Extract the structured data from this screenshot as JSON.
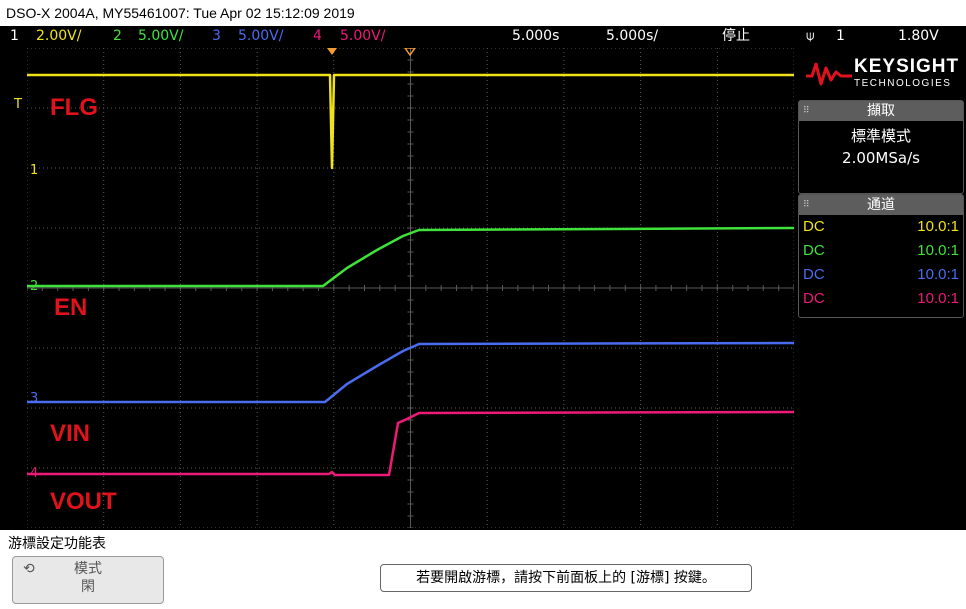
{
  "window": {
    "title": "DSO-X 2004A, MY55461007: Tue Apr 02 15:12:09 2019"
  },
  "statusbar": {
    "ch1_num": "1",
    "ch1_scale": "2.00V/",
    "ch2_num": "2",
    "ch2_scale": "5.00V/",
    "ch3_num": "3",
    "ch3_scale": "5.00V/",
    "ch4_num": "4",
    "ch4_scale": "5.00V/",
    "time_delay": "5.000s",
    "time_scale": "5.000s/",
    "run_state": "停止",
    "trigger_symbol": "⍦",
    "trigger_source": "1",
    "trigger_level": "1.80V"
  },
  "colors": {
    "ch1": "#f0e21a",
    "ch2": "#3fe23a",
    "ch3": "#4a6cf0",
    "ch4": "#ee1a78",
    "label": "#e0121b",
    "grid": "#5a5a5a",
    "trigger_marker": "#f29b30"
  },
  "markers": {
    "trigger": "T",
    "ch1": "1",
    "ch2": "2",
    "ch3": "3",
    "ch4": "4"
  },
  "signal_labels": {
    "flg": "FLG",
    "en": "EN",
    "vin": "VIN",
    "vout": "VOUT"
  },
  "brand": {
    "name": "KEYSIGHT",
    "sub": "TECHNOLOGIES"
  },
  "acquire": {
    "title": "擷取",
    "mode": "標準模式",
    "rate": "2.00MSa/s"
  },
  "channels": {
    "title": "通道",
    "rows": [
      {
        "coupling": "DC",
        "probe": "10.0:1"
      },
      {
        "coupling": "DC",
        "probe": "10.0:1"
      },
      {
        "coupling": "DC",
        "probe": "10.0:1"
      },
      {
        "coupling": "DC",
        "probe": "10.0:1"
      }
    ]
  },
  "softkeys": {
    "menu_title": "游標設定功能表",
    "mode_label": "模式",
    "mode_value": "閑",
    "mode_icon": "rotate-icon"
  },
  "message": "若要開啟游標，請按下前面板上的 [游標] 按鍵。"
}
